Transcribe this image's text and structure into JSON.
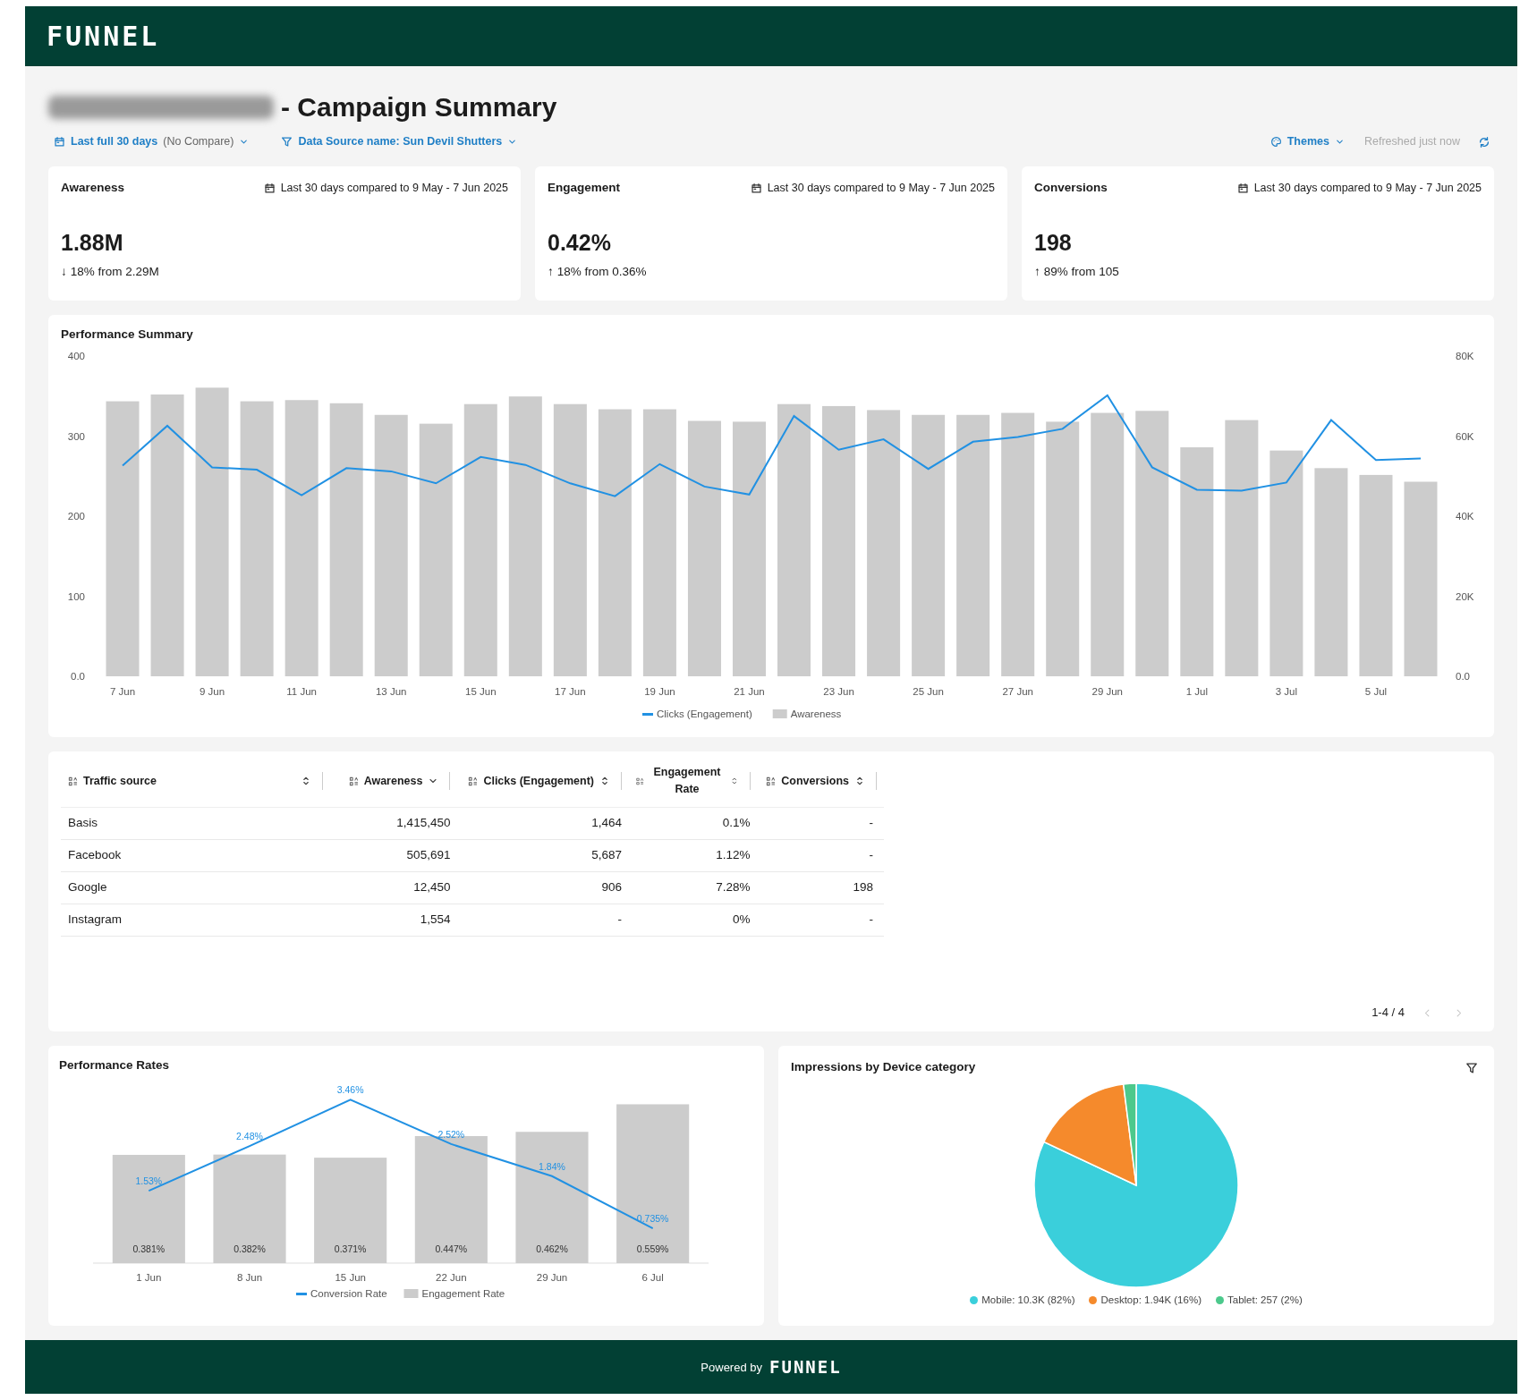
{
  "header": {
    "logo": "FUNNEL"
  },
  "title": {
    "redacted_prefix": true,
    "text": "- Campaign Summary"
  },
  "filters": [
    {
      "kind": "date",
      "label": "Last full 30 days",
      "note": "(No Compare)"
    },
    {
      "kind": "source",
      "label": "Data Source name: Sun Devil Shutters"
    }
  ],
  "themes": {
    "label": "Themes"
  },
  "refresh": {
    "label": "Refreshed just now"
  },
  "kpis": [
    {
      "title": "Awareness",
      "period": "Last 30 days compared to 9 May - 7 Jun 2025",
      "value": "1.88M",
      "arrow": "↓",
      "change": "18% from 2.29M"
    },
    {
      "title": "Engagement",
      "period": "Last 30 days compared to 9 May - 7 Jun 2025",
      "value": "0.42%",
      "arrow": "↑",
      "change": "18% from 0.36%"
    },
    {
      "title": "Conversions",
      "period": "Last 30 days compared to 9 May - 7 Jun 2025",
      "value": "198",
      "arrow": "↑",
      "change": "89% from 105"
    }
  ],
  "performance_summary": {
    "title": "Performance Summary",
    "chart_data": {
      "type": "bar",
      "categories": [
        "7 Jun",
        null,
        "9 Jun",
        null,
        "11 Jun",
        null,
        "13 Jun",
        null,
        "15 Jun",
        null,
        "17 Jun",
        null,
        "19 Jun",
        null,
        "21 Jun",
        null,
        "23 Jun",
        null,
        "25 Jun",
        null,
        "27 Jun",
        null,
        "29 Jun",
        null,
        "1 Jul",
        null,
        "3 Jul",
        null,
        "5 Jul",
        null
      ],
      "legend": "bottom",
      "ylim": [
        0,
        400
      ],
      "yticks": [
        {
          "value": 0,
          "label": "0.0"
        },
        {
          "value": 100,
          "label": "100"
        },
        {
          "value": 200,
          "label": "200"
        },
        {
          "value": 300,
          "label": "300"
        },
        {
          "value": 400,
          "label": "400"
        }
      ],
      "y2lim": [
        0,
        80000
      ],
      "y2ticks": [
        {
          "value": 0,
          "label": "0.0"
        },
        {
          "value": 20000,
          "label": "20K"
        },
        {
          "value": 40000,
          "label": "40K"
        },
        {
          "value": 60000,
          "label": "60K"
        },
        {
          "value": 80000,
          "label": "80K"
        }
      ],
      "series": [
        {
          "name": "Clicks (Engagement)",
          "type": "line",
          "color": "#2191e3",
          "values": [
            263,
            313,
            261,
            258,
            226,
            260,
            256,
            241,
            274,
            264,
            241,
            225,
            265,
            237,
            227,
            325,
            283,
            296,
            259,
            293,
            299,
            309,
            351,
            261,
            233,
            232,
            242,
            320,
            270,
            272
          ]
        },
        {
          "name": "Awareness",
          "type": "bar",
          "axis": "y2",
          "color": "#cccccc",
          "values": [
            68700,
            70400,
            72100,
            68700,
            69000,
            68200,
            65300,
            63100,
            68000,
            69900,
            68000,
            66700,
            66700,
            63800,
            63600,
            68000,
            67500,
            66500,
            65300,
            65300,
            65800,
            63600,
            65800,
            66300,
            57200,
            64000,
            56400,
            52000,
            50300,
            48600
          ]
        }
      ]
    }
  },
  "traffic_table": {
    "columns": [
      {
        "label": "Traffic source",
        "sorted": false
      },
      {
        "label": "Awareness",
        "sorted": true
      },
      {
        "label": "Clicks (Engagement)",
        "sorted": false
      },
      {
        "label": "Engagement Rate",
        "sorted": false
      },
      {
        "label": "Conversions",
        "sorted": false
      }
    ],
    "rows": [
      [
        "Basis",
        "1,415,450",
        "1,464",
        "0.1%",
        "-"
      ],
      [
        "Facebook",
        "505,691",
        "5,687",
        "1.12%",
        "-"
      ],
      [
        "Google",
        "12,450",
        "906",
        "7.28%",
        "198"
      ],
      [
        "Instagram",
        "1,554",
        "-",
        "0%",
        "-"
      ]
    ],
    "pagination": {
      "range": "1-4 / 4",
      "prev_disabled": true,
      "next_disabled": true
    }
  },
  "performance_rates": {
    "title": "Performance Rates",
    "chart_data": {
      "type": "bar",
      "categories": [
        "1 Jun",
        "8 Jun",
        "15 Jun",
        "22 Jun",
        "29 Jun",
        "6 Jul"
      ],
      "data_labels": true,
      "legend": "bottom",
      "series": [
        {
          "name": "Conversion Rate",
          "type": "line",
          "axis": "y2",
          "color": "#2191e3",
          "values": [
            1.53,
            2.48,
            3.46,
            2.52,
            1.84,
            0.735
          ],
          "value_labels": [
            "1.53%",
            "2.48%",
            "3.46%",
            "2.52%",
            "1.84%",
            "0.735%"
          ]
        },
        {
          "name": "Engagement Rate",
          "type": "bar",
          "color": "#cccccc",
          "values": [
            0.381,
            0.382,
            0.371,
            0.447,
            0.462,
            0.559
          ],
          "value_labels": [
            "0.381%",
            "0.382%",
            "0.371%",
            "0.447%",
            "0.462%",
            "0.559%"
          ]
        }
      ]
    }
  },
  "device_impressions": {
    "title": "Impressions by Device category",
    "chart_data": {
      "type": "pie",
      "categories": [
        "Mobile: 10.3K (82%)",
        "Desktop: 1.94K (16%)",
        "Tablet: 257 (2%)"
      ],
      "series": [
        {
          "values": [
            82,
            16,
            2
          ]
        }
      ],
      "colors": [
        "#3acfdb",
        "#f58a2c",
        "#4cc98c"
      ],
      "legend": "bottom"
    }
  },
  "footer": {
    "text": "Powered by",
    "logo": "FUNNEL"
  }
}
